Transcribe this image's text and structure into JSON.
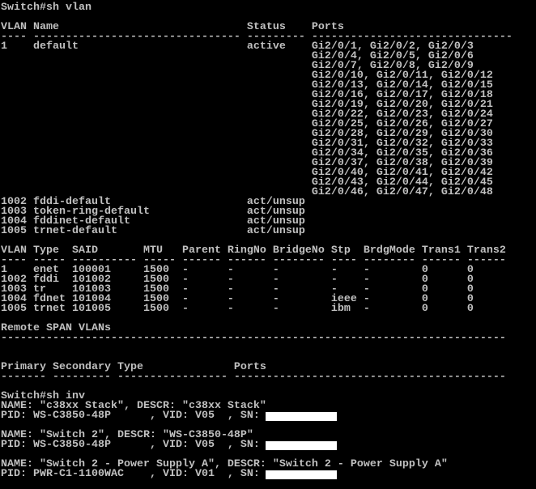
{
  "terminal": {
    "lines": [
      {
        "text": "Switch#sh vlan"
      },
      {
        "text": ""
      },
      {
        "text": "VLAN Name                             Status    Ports"
      },
      {
        "text": "---- -------------------------------- --------- -------------------------------"
      },
      {
        "text": "1    default                          active    Gi2/0/1, Gi2/0/2, Gi2/0/3"
      },
      {
        "text": "                                                Gi2/0/4, Gi2/0/5, Gi2/0/6"
      },
      {
        "text": "                                                Gi2/0/7, Gi2/0/8, Gi2/0/9"
      },
      {
        "text": "                                                Gi2/0/10, Gi2/0/11, Gi2/0/12"
      },
      {
        "text": "                                                Gi2/0/13, Gi2/0/14, Gi2/0/15"
      },
      {
        "text": "                                                Gi2/0/16, Gi2/0/17, Gi2/0/18"
      },
      {
        "text": "                                                Gi2/0/19, Gi2/0/20, Gi2/0/21"
      },
      {
        "text": "                                                Gi2/0/22, Gi2/0/23, Gi2/0/24"
      },
      {
        "text": "                                                Gi2/0/25, Gi2/0/26, Gi2/0/27"
      },
      {
        "text": "                                                Gi2/0/28, Gi2/0/29, Gi2/0/30"
      },
      {
        "text": "                                                Gi2/0/31, Gi2/0/32, Gi2/0/33"
      },
      {
        "text": "                                                Gi2/0/34, Gi2/0/35, Gi2/0/36"
      },
      {
        "text": "                                                Gi2/0/37, Gi2/0/38, Gi2/0/39"
      },
      {
        "text": "                                                Gi2/0/40, Gi2/0/41, Gi2/0/42"
      },
      {
        "text": "                                                Gi2/0/43, Gi2/0/44, Gi2/0/45"
      },
      {
        "text": "                                                Gi2/0/46, Gi2/0/47, Gi2/0/48"
      },
      {
        "text": "1002 fddi-default                     act/unsup"
      },
      {
        "text": "1003 token-ring-default               act/unsup"
      },
      {
        "text": "1004 fddinet-default                  act/unsup"
      },
      {
        "text": "1005 trnet-default                    act/unsup"
      },
      {
        "text": ""
      },
      {
        "text": "VLAN Type  SAID       MTU   Parent RingNo BridgeNo Stp  BrdgMode Trans1 Trans2"
      },
      {
        "text": "---- ----- ---------- ----- ------ ------ -------- ---- -------- ------ ------"
      },
      {
        "text": "1    enet  100001     1500  -      -      -        -    -        0      0"
      },
      {
        "text": "1002 fddi  101002     1500  -      -      -        -    -        0      0"
      },
      {
        "text": "1003 tr    101003     1500  -      -      -        -    -        0      0"
      },
      {
        "text": "1004 fdnet 101004     1500  -      -      -        ieee -        0      0"
      },
      {
        "text": "1005 trnet 101005     1500  -      -      -        ibm  -        0      0"
      },
      {
        "text": ""
      },
      {
        "text": "Remote SPAN VLANs"
      },
      {
        "text": "------------------------------------------------------------------------------"
      },
      {
        "text": ""
      },
      {
        "text": ""
      },
      {
        "text": "Primary Secondary Type              Ports"
      },
      {
        "text": "------- --------- ----------------- ------------------------------------------"
      },
      {
        "text": ""
      },
      {
        "text": "Switch#sh inv"
      },
      {
        "text": "NAME: \"c38xx Stack\", DESCR: \"c38xx Stack\""
      },
      {
        "text": "PID: WS-C3850-48P      , VID: V05  , SN: ",
        "redacted": true
      },
      {
        "text": ""
      },
      {
        "text": "NAME: \"Switch 2\", DESCR: \"WS-C3850-48P\""
      },
      {
        "text": "PID: WS-C3850-48P      , VID: V05  , SN: ",
        "redacted": true
      },
      {
        "text": ""
      },
      {
        "text": "NAME: \"Switch 2 - Power Supply A\", DESCR: \"Switch 2 - Power Supply A\""
      },
      {
        "text": "PID: PWR-C1-1100WAC    , VID: V01  , SN: ",
        "redacted": true
      }
    ]
  }
}
